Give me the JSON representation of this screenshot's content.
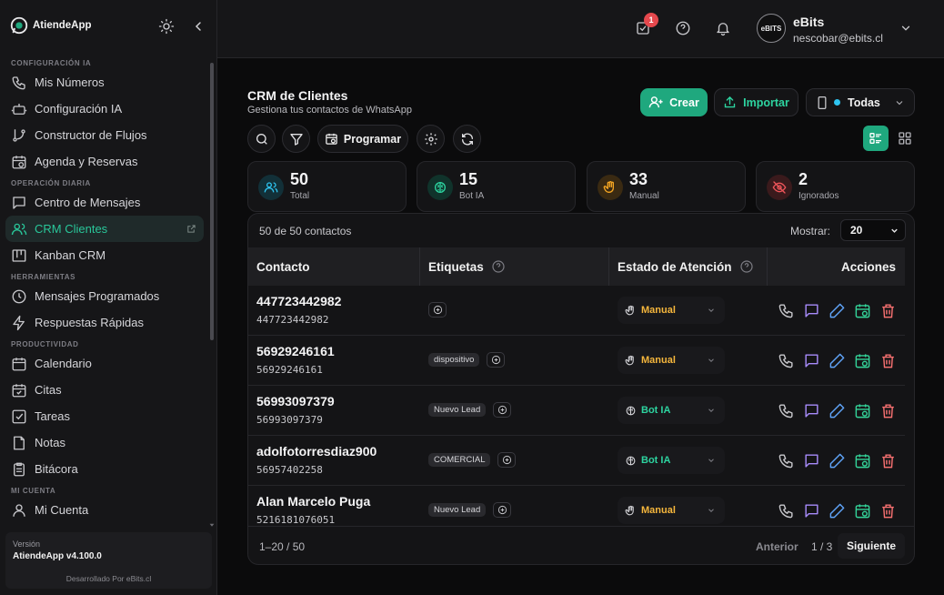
{
  "brand": {
    "name": "AtiendeApp"
  },
  "sidebar": {
    "sections": [
      {
        "title": "CONFIGURACIÓN IA",
        "items": [
          {
            "label": "Mis Números",
            "icon": "phone-icon"
          },
          {
            "label": "Configuración IA",
            "icon": "robot-icon"
          },
          {
            "label": "Constructor de Flujos",
            "icon": "flow-icon"
          },
          {
            "label": "Agenda y Reservas",
            "icon": "calendar-clock-icon"
          }
        ]
      },
      {
        "title": "OPERACIÓN DIARIA",
        "items": [
          {
            "label": "Centro de Mensajes",
            "icon": "message-icon"
          },
          {
            "label": "CRM Clientes",
            "icon": "users-icon",
            "active": true
          },
          {
            "label": "Kanban CRM",
            "icon": "kanban-icon"
          }
        ]
      },
      {
        "title": "HERRAMIENTAS",
        "items": [
          {
            "label": "Mensajes Programados",
            "icon": "clock-icon"
          },
          {
            "label": "Respuestas Rápidas",
            "icon": "bolt-icon"
          }
        ]
      },
      {
        "title": "PRODUCTIVIDAD",
        "items": [
          {
            "label": "Calendario",
            "icon": "calendar-icon"
          },
          {
            "label": "Citas",
            "icon": "calendar-check-icon"
          },
          {
            "label": "Tareas",
            "icon": "checkbox-icon"
          },
          {
            "label": "Notas",
            "icon": "note-icon"
          },
          {
            "label": "Bitácora",
            "icon": "clipboard-icon"
          }
        ]
      },
      {
        "title": "MI CUENTA",
        "items": [
          {
            "label": "Mi Cuenta",
            "icon": "user-icon"
          }
        ]
      }
    ],
    "version_label": "Versión",
    "version_value": "AtiendeApp v4.100.0",
    "credit": "Desarrollado Por eBits.cl"
  },
  "topbar": {
    "tasks_badge": "1",
    "avatar_text": "eBITS",
    "user_name": "eBits",
    "user_email": "nescobar@ebits.cl"
  },
  "page": {
    "title": "CRM de Clientes",
    "subtitle": "Gestiona tus contactos de WhatsApp",
    "create_label": "Crear",
    "import_label": "Importar",
    "filter_label": "Todas",
    "schedule_label": "Programar"
  },
  "stats": [
    {
      "value": "50",
      "label": "Total",
      "icon": "users-icon",
      "color": "#2ec4f0"
    },
    {
      "value": "15",
      "label": "Bot IA",
      "icon": "brain-icon",
      "color": "#2dd4a0"
    },
    {
      "value": "33",
      "label": "Manual",
      "icon": "hand-icon",
      "color": "#f5a623"
    },
    {
      "value": "2",
      "label": "Ignorados",
      "icon": "eye-off-icon",
      "color": "#f0555a"
    }
  ],
  "table": {
    "count_text": "50 de 50 contactos",
    "show_label": "Mostrar:",
    "show_value": "20",
    "headers": {
      "contact": "Contacto",
      "tags": "Etiquetas",
      "status": "Estado de Atención",
      "actions": "Acciones"
    },
    "rows": [
      {
        "name": "447723442982",
        "phone": "447723442982",
        "tags": [],
        "status": "Manual"
      },
      {
        "name": "56929246161",
        "phone": "56929246161",
        "tags": [
          "dispositivo"
        ],
        "status": "Manual"
      },
      {
        "name": "56993097379",
        "phone": "56993097379",
        "tags": [
          "Nuevo Lead"
        ],
        "status": "Bot IA"
      },
      {
        "name": "adolfotorresdiaz900",
        "phone": "56957402258",
        "tags": [
          "COMERCIAL"
        ],
        "status": "Bot IA"
      },
      {
        "name": "Alan Marcelo Puga",
        "phone": "5216181076051",
        "tags": [
          "Nuevo Lead"
        ],
        "status": "Manual"
      }
    ],
    "range_text": "1–20 / 50",
    "prev_label": "Anterior",
    "page_text": "1 / 3",
    "next_label": "Siguiente"
  },
  "colors": {
    "accent": "#1fa87e",
    "manual": "#f5b63c",
    "bot": "#2dd4a0"
  }
}
